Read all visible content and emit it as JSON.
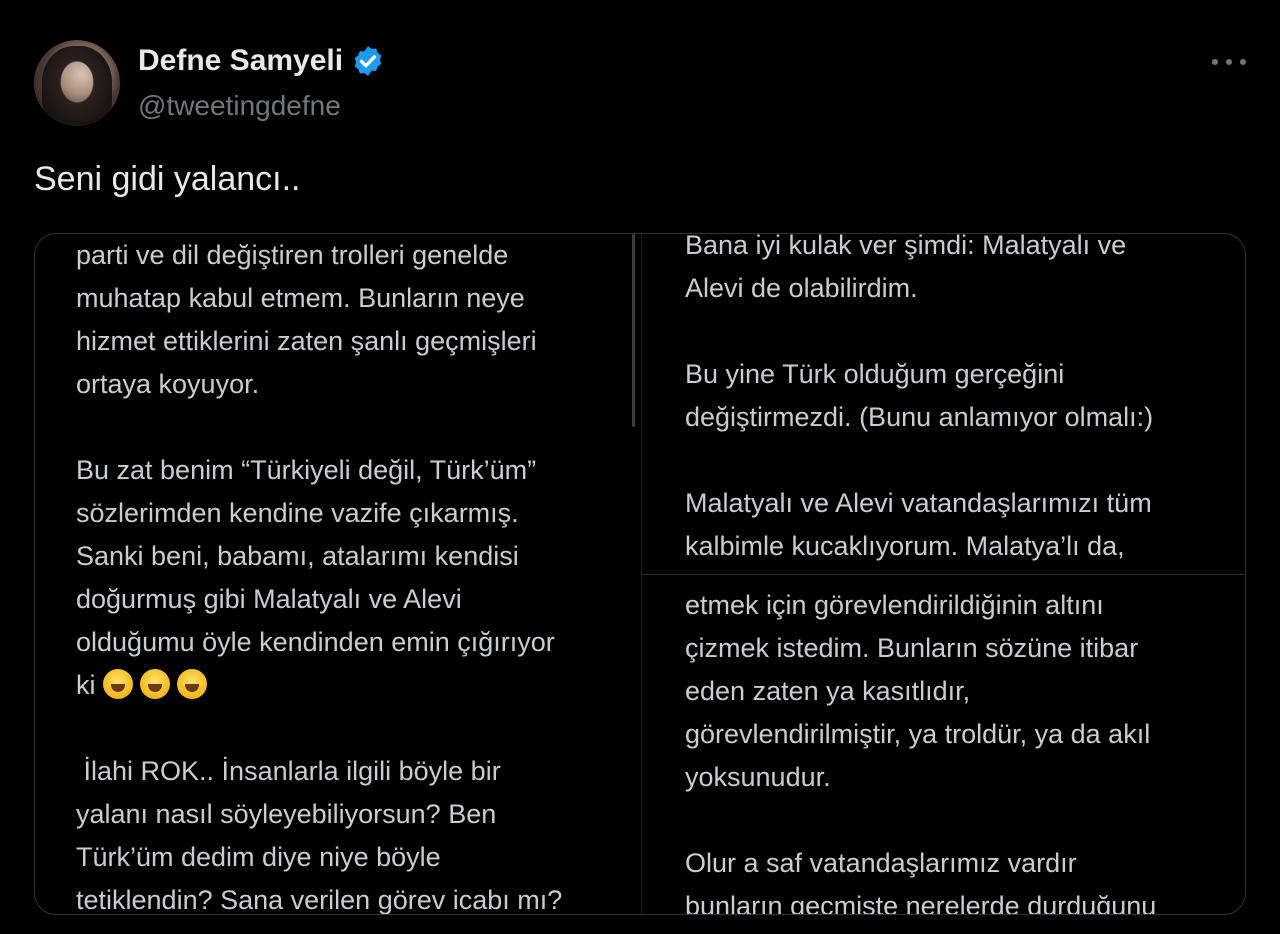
{
  "author": {
    "display_name": "Defne Samyeli",
    "handle": "@tweetingdefne",
    "verified": true
  },
  "tweet": {
    "text": "Seni gidi yalancı.."
  },
  "image": {
    "left_column": [
      "parti ve dil değiştiren trolleri genelde",
      "muhatap kabul etmem. Bunların neye",
      "hizmet ettiklerini zaten şanlı geçmişleri",
      "ortaya koyuyor.",
      "",
      "Bu zat benim “Türkiyeli değil, Türk’üm”",
      "sözlerimden kendine vazife çıkarmış.",
      "Sanki beni, babamı, atalarımı kendisi",
      "doğurmuş gibi  Malatyalı ve Alevi",
      "olduğumu öyle kendinden emin çığırıyor",
      "ki"
    ],
    "left_column_after_emoji": [
      "",
      " İlahi ROK.. İnsanlarla ilgili böyle bir",
      "yalanı nasıl söyleyebiliyorsun? Ben",
      "Türk’üm dedim diye niye böyle",
      "tetiklendin? Sana verilen görev icabı mı?"
    ],
    "emoji_count": 3,
    "right_top": [
      "Bana iyi kulak ver şimdi: Malatyalı ve",
      "Alevi de olabilirdim.",
      "",
      "Bu yine Türk olduğum gerçeğini",
      "değiştirmezdi. (Bunu anlamıyor olmalı:)",
      "",
      "Malatyalı ve Alevi vatandaşlarımızı tüm",
      "kalbimle kucaklıyorum. Malatya’lı da,"
    ],
    "right_bottom": [
      "etmek için görevlendirildiğinin altını",
      "çizmek istedim. Bunların sözüne itibar",
      "eden zaten ya kasıtlıdır,",
      "görevlendirilmiştir, ya troldür, ya da akıl",
      "yoksunudur.",
      "",
      "Olur a saf vatandaşlarımız vardır",
      "bunların geçmişte nerelerde durduğunu"
    ]
  },
  "colors": {
    "background": "#000000",
    "text_primary": "#e7e9ea",
    "text_secondary": "#71767b",
    "verified_blue": "#1d9bf0"
  },
  "icons": {
    "verified": "verified-badge-icon",
    "more": "more-dots-icon",
    "emoji": "face-with-tears-of-joy"
  }
}
